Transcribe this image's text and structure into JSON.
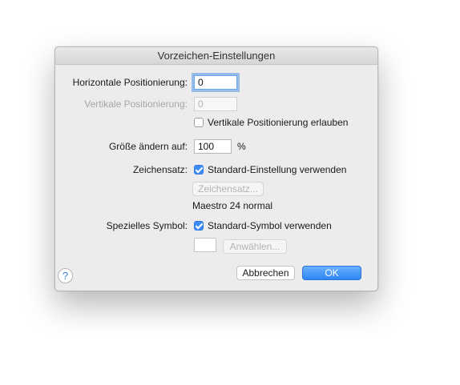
{
  "dialog": {
    "title": "Vorzeichen-Einstellungen",
    "horizontal_label": "Horizontale Positionierung:",
    "horizontal_value": "0",
    "vertical_label": "Vertikale Positionierung:",
    "vertical_value": "0",
    "allow_vertical_label": "Vertikale Positionierung erlauben",
    "allow_vertical_checked": false,
    "size_label": "Größe ändern auf:",
    "size_value": "100",
    "size_unit": "%",
    "font_label": "Zeichensatz:",
    "font_default_label": "Standard-Einstellung verwenden",
    "font_default_checked": true,
    "font_button": "Zeichensatz...",
    "font_info": "Maestro 24 normal",
    "symbol_label": "Spezielles Symbol:",
    "symbol_default_label": "Standard-Symbol verwenden",
    "symbol_default_checked": true,
    "symbol_button": "Anwählen...",
    "cancel_button": "Abbrechen",
    "ok_button": "OK",
    "help_button": "?"
  }
}
